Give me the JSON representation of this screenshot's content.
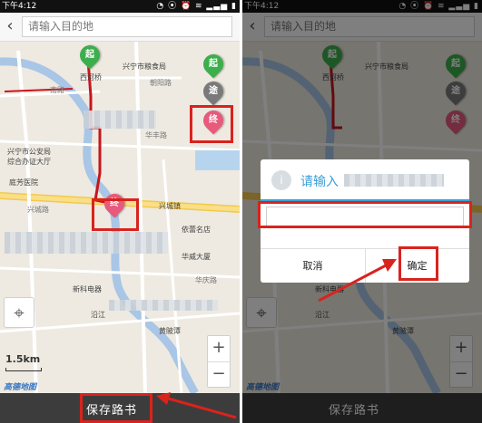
{
  "status": {
    "time": "下午4:12",
    "icons": "◔ ⦿ ⏰ ≋ ▂▃▅ ▮"
  },
  "search": {
    "placeholder": "请输入目的地"
  },
  "map": {
    "labels": {
      "xining_market": "兴宁市粮食局",
      "xihe_bridge": "西河桥",
      "police": "兴宁市公安局",
      "police_sub": "综合办证大厅",
      "hospital": "庭芳医院",
      "xingcheng": "兴城镇",
      "yidie": "依蕾名店",
      "huawei": "华威大厦",
      "xinke": "新科电器",
      "yanjiang": "沿江",
      "huangmou": "黄陂潭",
      "street1": "华丰路",
      "street2": "兴城路",
      "street3": "南路",
      "street4": "朝阳路",
      "street5": "华庆路"
    },
    "pins": {
      "start": "起",
      "via": "途",
      "end": "终"
    },
    "scale": "1.5km",
    "logo": "高德地图",
    "zoom_in": "+",
    "zoom_out": "−"
  },
  "bottom": {
    "save_label": "保存路书"
  },
  "dialog": {
    "title": "请输入",
    "cancel": "取消",
    "confirm": "确定",
    "icon": "i"
  },
  "colors": {
    "route": "#c8151b",
    "annotation": "#d9231d",
    "dialog_accent": "#3d9fd6"
  }
}
